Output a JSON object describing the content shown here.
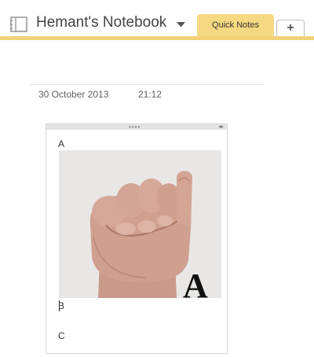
{
  "header": {
    "notebook_title": "Hemant's Notebook",
    "notebook_icon": "notebook-icon",
    "dropdown_icon": "chevron-down-icon",
    "tabs": [
      {
        "label": "Quick Notes",
        "active": true
      },
      {
        "label": "+",
        "active": false
      }
    ],
    "accent_color": "#f1d276"
  },
  "page": {
    "date": "30 October 2013",
    "time": "21:12"
  },
  "note": {
    "drag_handle": "••••",
    "resize_handle": "◂▸",
    "lines": [
      "A",
      "B",
      "C"
    ],
    "image": "hand-sign-letter-a"
  }
}
